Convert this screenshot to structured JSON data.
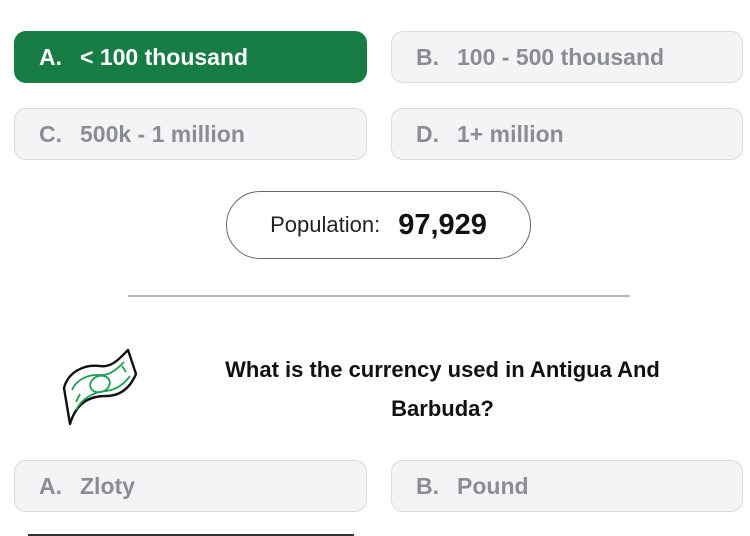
{
  "question1": {
    "options": [
      {
        "letter": "A.",
        "label": "< 100 thousand",
        "selected": true
      },
      {
        "letter": "B.",
        "label": "100 - 500 thousand",
        "selected": false
      },
      {
        "letter": "C.",
        "label": "500k - 1 million",
        "selected": false
      },
      {
        "letter": "D.",
        "label": "1+ million",
        "selected": false
      }
    ]
  },
  "population": {
    "label": "Population:",
    "value": "97,929"
  },
  "question2": {
    "icon": "money-bill-icon",
    "text": "What is the currency used in Antigua And Barbuda?",
    "options": [
      {
        "letter": "A.",
        "label": "Zloty"
      },
      {
        "letter": "B.",
        "label": "Pound"
      }
    ]
  },
  "colors": {
    "selected": "#177d45",
    "option_bg": "#f3f4f6",
    "option_text": "#8a8d92"
  }
}
